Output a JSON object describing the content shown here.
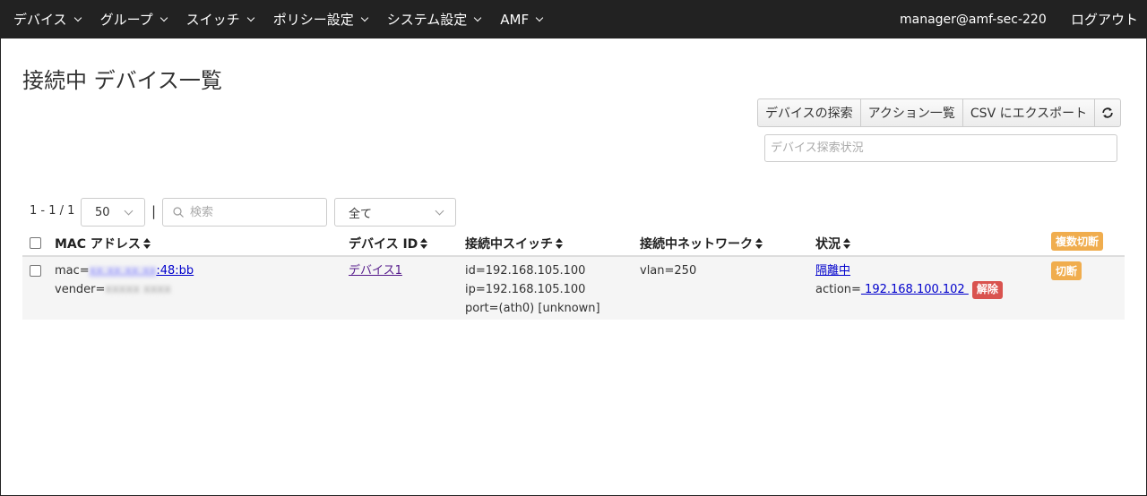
{
  "nav": {
    "items": [
      {
        "label": "デバイス"
      },
      {
        "label": "グループ"
      },
      {
        "label": "スイッチ"
      },
      {
        "label": "ポリシー設定"
      },
      {
        "label": "システム設定"
      },
      {
        "label": "AMF"
      }
    ],
    "user": "manager@amf-sec-220",
    "logout": "ログアウト"
  },
  "page": {
    "title": "接続中 デバイス一覧"
  },
  "actions": {
    "discover": "デバイスの探索",
    "action_list": "アクション一覧",
    "export_csv": "CSV にエクスポート",
    "refresh_icon": "refresh-icon"
  },
  "status_field": {
    "placeholder": "デバイス探索状況"
  },
  "toolbar": {
    "pager": "1 - 1 / 1",
    "page_size": "50",
    "separator": "|",
    "search_placeholder": "検索",
    "filter": "全て"
  },
  "table": {
    "columns": {
      "mac": "MAC アドレス",
      "device_id": "デバイス ID",
      "switch": "接続中スイッチ",
      "network": "接続中ネットワーク",
      "status": "状況"
    },
    "bulk_disconnect": "複数切断",
    "rows": [
      {
        "mac_prefix": "mac=",
        "mac_hidden": "xx:xx:xx:xx",
        "mac_suffix": ":48:bb",
        "vendor_prefix": "vender=",
        "vendor_hidden": "xxxxx xxxx",
        "device_id": "デバイス1",
        "switch_id": "id=192.168.105.100",
        "switch_ip": "ip=192.168.105.100",
        "switch_port": "port=(ath0) [unknown]",
        "network": "vlan=250",
        "status": "隔離中",
        "action_prefix": "action=",
        "action_link": " 192.168.100.102 ",
        "release": "解除",
        "disconnect": "切断"
      }
    ]
  },
  "colors": {
    "navbar": "#222222",
    "warning": "#f0ad4e",
    "danger": "#d9534f",
    "link": "#0000cc"
  }
}
